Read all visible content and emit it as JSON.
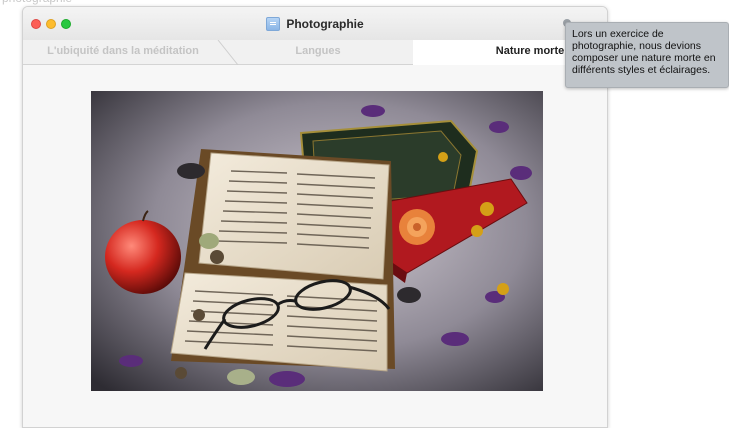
{
  "background_hint": "photographie",
  "window": {
    "title": "Photographie",
    "title_icon": "document-icon"
  },
  "tabs": [
    {
      "label": "L'ubiquité dans la méditation",
      "selected": false
    },
    {
      "label": "Langues",
      "selected": false
    },
    {
      "label": "Nature morte",
      "selected": true
    }
  ],
  "tooltip": {
    "text": "Lors un exercice de photographie, nous devions composer une nature morte en différents styles et éclairages."
  },
  "colors": {
    "close": "#fc5f57",
    "minimize": "#fdbc2e",
    "zoom": "#28c840",
    "tooltip_bg": "#bfc4c9"
  }
}
